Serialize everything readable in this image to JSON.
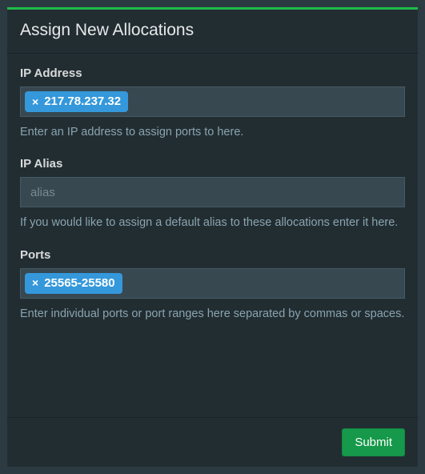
{
  "header": {
    "title": "Assign New Allocations"
  },
  "ip": {
    "label": "IP Address",
    "tag": "217.78.237.32",
    "help": "Enter an IP address to assign ports to here."
  },
  "alias": {
    "label": "IP Alias",
    "placeholder": "alias",
    "value": "",
    "help": "If you would like to assign a default alias to these allocations enter it here."
  },
  "ports": {
    "label": "Ports",
    "tag": "25565-25580",
    "help": "Enter individual ports or port ranges here separated by commas or spaces."
  },
  "footer": {
    "submit_label": "Submit"
  }
}
